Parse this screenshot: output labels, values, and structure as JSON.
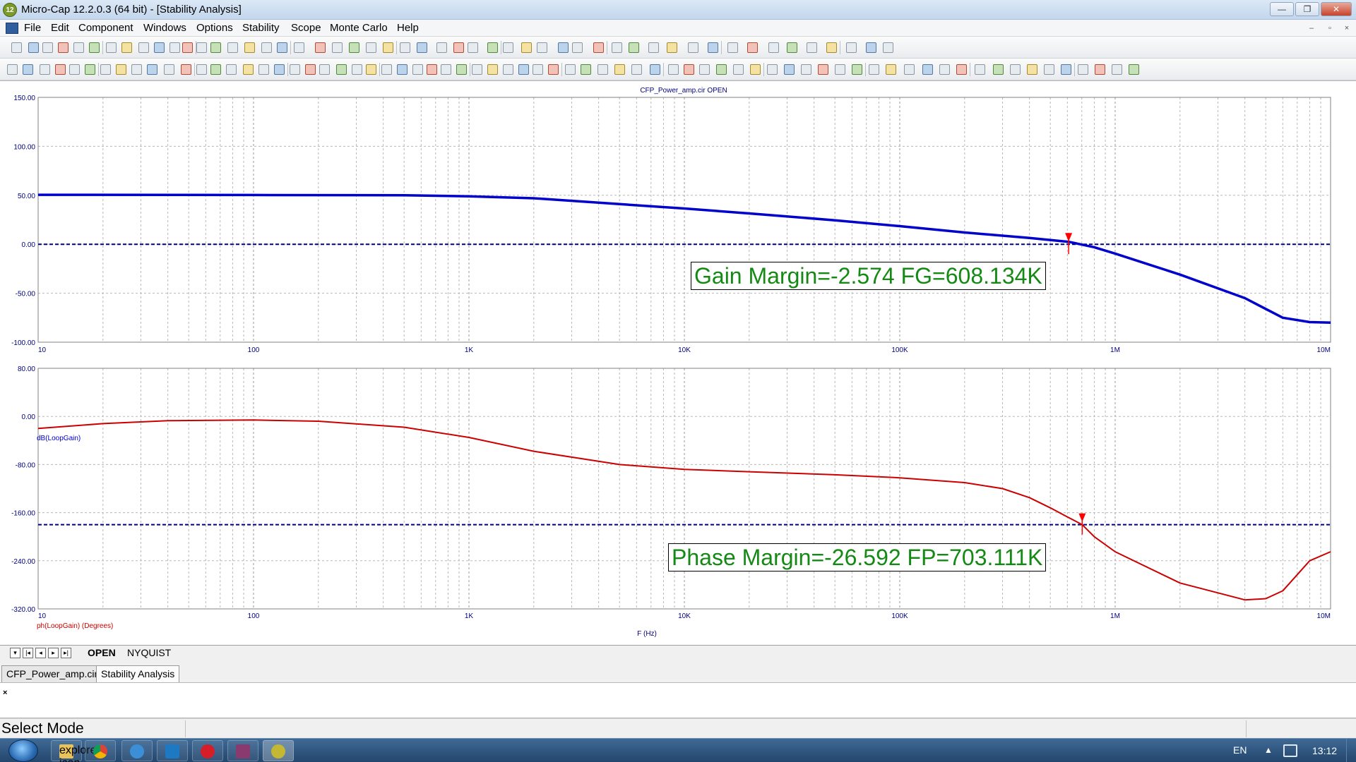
{
  "window": {
    "app_icon_text": "12",
    "title": "Micro-Cap 12.2.0.3 (64 bit) - [Stability Analysis]",
    "minimize": "—",
    "restore": "❐",
    "close": "✕"
  },
  "menu": {
    "items": [
      "File",
      "Edit",
      "Component",
      "Windows",
      "Options",
      "Stability",
      "Scope",
      "Monte Carlo",
      "Help"
    ],
    "mdi_controls": [
      "–",
      "▫",
      "×"
    ]
  },
  "plot": {
    "caption": "CFP_Power_amp.cir OPEN",
    "xlabel": "F (Hz)",
    "gain_marker_label": "Gain Margin=-2.574 FG=608.134K",
    "phase_marker_label": "Phase Margin=-26.592 FP=703.111K"
  },
  "chart_data": [
    {
      "type": "line",
      "title": "CFP_Power_amp.cir OPEN",
      "xlabel": "",
      "ylabel": "dB(LoopGain)",
      "xscale": "log",
      "xlim": [
        10,
        10000000
      ],
      "ylim": [
        -100,
        150
      ],
      "x_tick_labels": [
        "10",
        "100",
        "1K",
        "10K",
        "100K",
        "1M",
        "10M"
      ],
      "y_tick_labels": [
        "150.00",
        "100.00",
        "50.00",
        "0.00",
        "-50.00",
        "-100.00"
      ],
      "grid": true,
      "reference_line": {
        "y": 0,
        "color": "#000080",
        "style": "dashed"
      },
      "marker": {
        "x": 608134,
        "y": 0,
        "label": "Gain Margin=-2.574 FG=608.134K"
      },
      "series": [
        {
          "color": "#0000cc",
          "x": [
            10,
            100,
            500,
            1000,
            2000,
            5000,
            10000,
            20000,
            50000,
            100000,
            200000,
            400000,
            608134,
            800000,
            1000000,
            2000000,
            4000000,
            6000000,
            8000000,
            10000000
          ],
          "y": [
            50.5,
            50.3,
            50,
            49,
            47,
            41,
            36.5,
            31.5,
            24.5,
            18.5,
            12,
            6.5,
            2.5,
            -3,
            -9.5,
            -31,
            -55,
            -75,
            -79.5,
            -80
          ]
        }
      ]
    },
    {
      "type": "line",
      "title": "",
      "xlabel": "F (Hz)",
      "ylabel": "ph(LoopGain) (Degrees)",
      "xscale": "log",
      "xlim": [
        10,
        10000000
      ],
      "ylim": [
        -320,
        80
      ],
      "x_tick_labels": [
        "10",
        "100",
        "1K",
        "10K",
        "100K",
        "1M",
        "10M"
      ],
      "y_tick_labels": [
        "80.00",
        "0.00",
        "-80.00",
        "-160.00",
        "-240.00",
        "-320.00"
      ],
      "grid": true,
      "reference_line": {
        "y": -180,
        "color": "#000080",
        "style": "dashed"
      },
      "marker": {
        "x": 703111,
        "y": -180,
        "label": "Phase Margin=-26.592 FP=703.111K"
      },
      "series": [
        {
          "color": "#cc0000",
          "x": [
            10,
            20,
            40,
            100,
            200,
            500,
            1000,
            2000,
            5000,
            10000,
            20000,
            50000,
            100000,
            200000,
            300000,
            400000,
            500000,
            600000,
            703111,
            800000,
            1000000,
            2000000,
            4000000,
            5000000,
            6000000,
            8000000,
            10000000
          ],
          "y": [
            -20,
            -12,
            -7,
            -6,
            -8,
            -18,
            -35,
            -58,
            -80,
            -88,
            -92,
            -97,
            -102,
            -110,
            -120,
            -135,
            -152,
            -167,
            -180,
            -200,
            -225,
            -277,
            -305,
            -303,
            -290,
            -240,
            -225
          ]
        }
      ]
    }
  ],
  "plot_tabs": {
    "nav": [
      "▾",
      "|◂",
      "◂",
      "▸",
      "▸|"
    ],
    "tabs": [
      "OPEN",
      "NYQUIST"
    ]
  },
  "doc_tabs": [
    "CFP_Power_amp.cir",
    "Stability Analysis"
  ],
  "message_close": "×",
  "status": {
    "mode": "Select Mode"
  },
  "taskbar": {
    "apps": [
      "explorer-icon",
      "chrome-icon",
      "ie-icon",
      "messenger-icon",
      "opera-icon",
      "winrar-icon",
      "microcap-icon"
    ],
    "lang": "EN",
    "tray_arrow": "▲",
    "clock": "13:12"
  },
  "colors": {
    "gain_curve": "#0000cc",
    "phase_curve": "#cc0000",
    "reference": "#000080",
    "grid": "#808080",
    "marker": "#ff0000",
    "marker_text": "#148a14"
  }
}
